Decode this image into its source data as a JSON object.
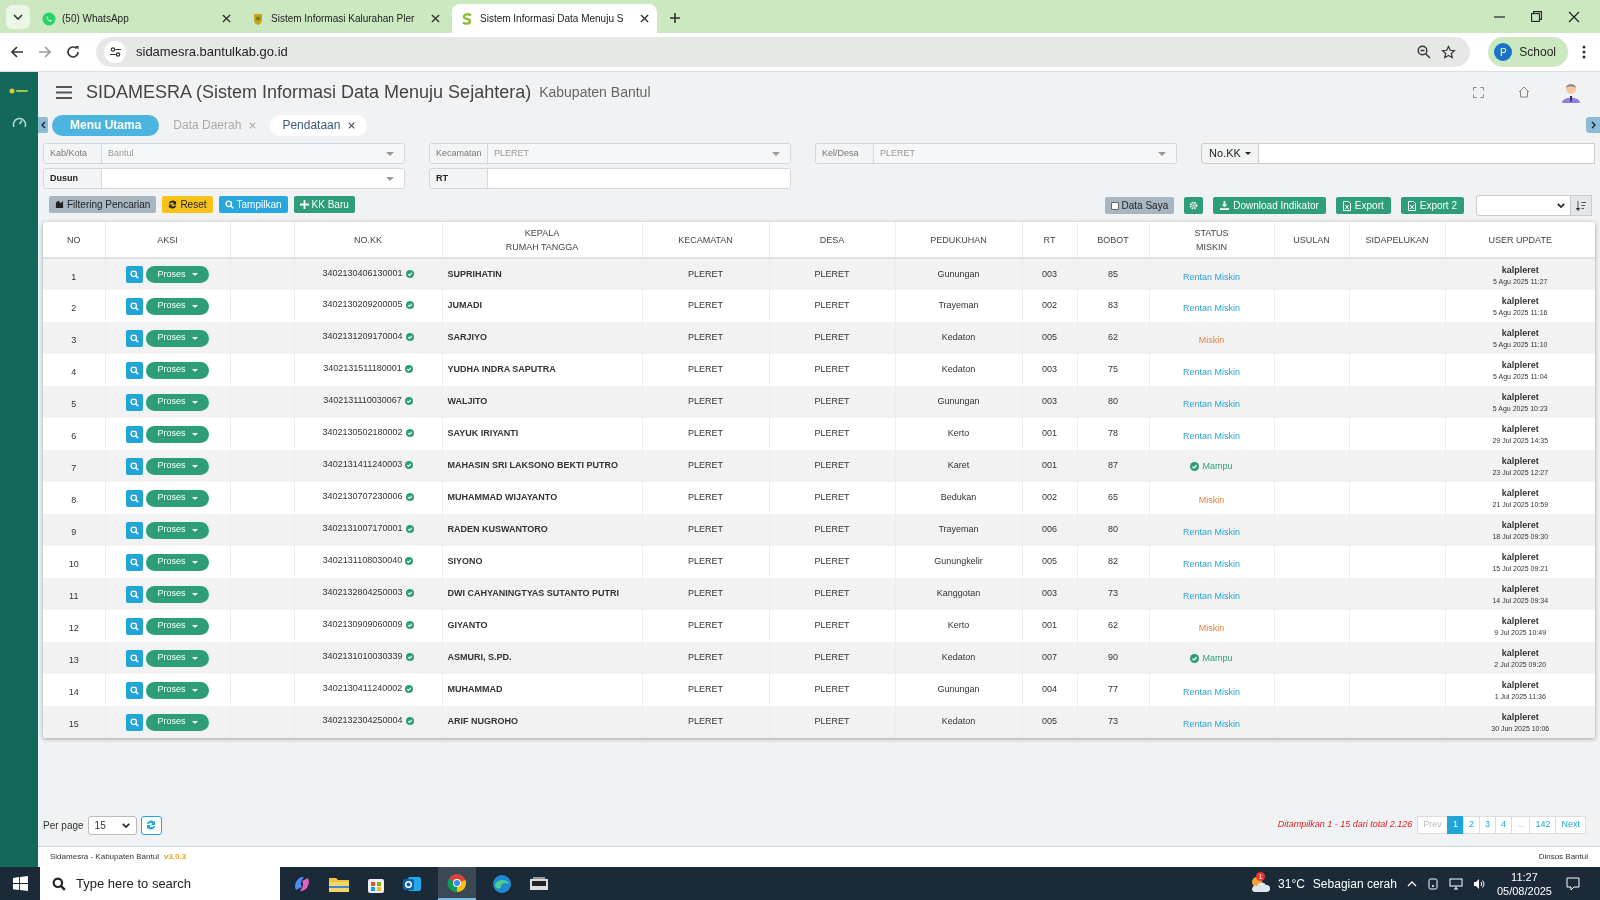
{
  "browser": {
    "tabs": [
      {
        "title": "(50) WhatsApp",
        "selected": false,
        "kind": "whatsapp"
      },
      {
        "title": "Sistem Informasi Kalurahan Pler",
        "selected": false,
        "kind": "emblem"
      },
      {
        "title": "Sistem Informasi Data Menuju S",
        "selected": true,
        "kind": "logo"
      }
    ],
    "url": "sidamesra.bantulkab.go.id",
    "profile": {
      "initial": "P",
      "label": "School"
    }
  },
  "app": {
    "title": "SIDAMESRA (Sistem Informasi Data Menuju Sejahtera)",
    "subtitle": "Kabupaten Bantul",
    "tabs": [
      {
        "label": "Menu Utama",
        "kind": "home",
        "selected": false,
        "closable": false
      },
      {
        "label": "Data Daerah",
        "kind": "page",
        "selected": false,
        "closable": true
      },
      {
        "label": "Pendataan",
        "kind": "page",
        "selected": true,
        "closable": true
      }
    ]
  },
  "filters": {
    "fields": [
      {
        "label": "Kab/Kota",
        "value": "Bantul",
        "disabled": true,
        "kind": "select"
      },
      {
        "label": "Kecamatan",
        "value": "PLERET",
        "disabled": true,
        "kind": "select"
      },
      {
        "label": "Kel/Desa",
        "value": "PLERET",
        "disabled": true,
        "kind": "select"
      },
      {
        "label": "Dusun",
        "disabled": false,
        "kind": "select"
      },
      {
        "label": "RT",
        "disabled": false,
        "kind": "text"
      }
    ],
    "search_by": "No.KK"
  },
  "toolbar": {
    "left": [
      {
        "label": "Filtering Pencarian",
        "kind": "filter"
      },
      {
        "label": "Reset",
        "kind": "reset"
      },
      {
        "label": "Tampilkan",
        "kind": "show"
      },
      {
        "label": "KK Baru",
        "kind": "add"
      }
    ],
    "data_saya": {
      "label": "Data Saya",
      "checked": false
    },
    "right": [
      {
        "label": "Download Indikator",
        "kind": "download"
      },
      {
        "label": "Export",
        "kind": "excel"
      },
      {
        "label": "Export 2",
        "kind": "excel"
      }
    ]
  },
  "table": {
    "columns": [
      "NO",
      "AKSI",
      "NO.KK",
      "KEPALA\nRUMAH TANGGA",
      "KECAMATAN",
      "DESA",
      "PEDUKUHAN",
      "RT",
      "BOBOT",
      "STATUS\nMISKIN",
      "USULAN",
      "SIDAPELUKAN",
      "USER UPDATE"
    ],
    "rows": [
      {
        "no": "1",
        "action": "Proses",
        "no_kk": "3402130406130001",
        "verified": true,
        "kepala": "SUPRIHATIN",
        "kecamatan": "PLERET",
        "desa": "PLERET",
        "pedukuhan": "Gunungan",
        "rt": "003",
        "bobot": "85",
        "status": {
          "label": "Rentan Miskin",
          "kind": "rentan"
        },
        "user": "kalpleret",
        "updated": "5 Agu 2025 11:27"
      },
      {
        "no": "2",
        "action": "Proses",
        "no_kk": "3402130209200005",
        "verified": true,
        "kepala": "JUMADI",
        "kecamatan": "PLERET",
        "desa": "PLERET",
        "pedukuhan": "Trayeman",
        "rt": "002",
        "bobot": "83",
        "status": {
          "label": "Rentan Miskin",
          "kind": "rentan"
        },
        "user": "kalpleret",
        "updated": "5 Agu 2025 11:16"
      },
      {
        "no": "3",
        "action": "Proses",
        "no_kk": "3402131209170004",
        "verified": true,
        "kepala": "SARJIYO",
        "kecamatan": "PLERET",
        "desa": "PLERET",
        "pedukuhan": "Kedaton",
        "rt": "005",
        "bobot": "62",
        "status": {
          "label": "Miskin",
          "kind": "miskin"
        },
        "user": "kalpleret",
        "updated": "5 Agu 2025 11:10"
      },
      {
        "no": "4",
        "action": "Proses",
        "no_kk": "3402131511180001",
        "verified": true,
        "kepala": "YUDHA INDRA SAPUTRA",
        "kecamatan": "PLERET",
        "desa": "PLERET",
        "pedukuhan": "Kedaton",
        "rt": "003",
        "bobot": "75",
        "status": {
          "label": "Rentan Miskin",
          "kind": "rentan"
        },
        "user": "kalpleret",
        "updated": "5 Agu 2025 11:04"
      },
      {
        "no": "5",
        "action": "Proses",
        "no_kk": "3402131110030067",
        "verified": true,
        "kepala": "WALJITO",
        "kecamatan": "PLERET",
        "desa": "PLERET",
        "pedukuhan": "Gunungan",
        "rt": "003",
        "bobot": "80",
        "status": {
          "label": "Rentan Miskin",
          "kind": "rentan"
        },
        "user": "kalpleret",
        "updated": "5 Agu 2025 10:23"
      },
      {
        "no": "6",
        "action": "Proses",
        "no_kk": "3402130502180002",
        "verified": true,
        "kepala": "SAYUK IRIYANTI",
        "kecamatan": "PLERET",
        "desa": "PLERET",
        "pedukuhan": "Kerto",
        "rt": "001",
        "bobot": "78",
        "status": {
          "label": "Rentan Miskin",
          "kind": "rentan"
        },
        "user": "kalpleret",
        "updated": "29 Jul 2025 14:35"
      },
      {
        "no": "7",
        "action": "Proses",
        "no_kk": "3402131411240003",
        "verified": true,
        "kepala": "MAHASIN SRI LAKSONO BEKTI PUTRO",
        "kecamatan": "PLERET",
        "desa": "PLERET",
        "pedukuhan": "Karet",
        "rt": "001",
        "bobot": "87",
        "status": {
          "label": "Mampu",
          "kind": "mampu"
        },
        "user": "kalpleret",
        "updated": "23 Jul 2025 12:27"
      },
      {
        "no": "8",
        "action": "Proses",
        "no_kk": "3402130707230006",
        "verified": true,
        "kepala": "MUHAMMAD WIJAYANTO",
        "kecamatan": "PLERET",
        "desa": "PLERET",
        "pedukuhan": "Bedukan",
        "rt": "002",
        "bobot": "65",
        "status": {
          "label": "Miskin",
          "kind": "miskin"
        },
        "user": "kalpleret",
        "updated": "21 Jul 2025 10:59"
      },
      {
        "no": "9",
        "action": "Proses",
        "no_kk": "3402131007170001",
        "verified": true,
        "kepala": "RADEN KUSWANTORO",
        "kecamatan": "PLERET",
        "desa": "PLERET",
        "pedukuhan": "Trayeman",
        "rt": "006",
        "bobot": "80",
        "status": {
          "label": "Rentan Miskin",
          "kind": "rentan"
        },
        "user": "kalpleret",
        "updated": "18 Jul 2025 09:30"
      },
      {
        "no": "10",
        "action": "Proses",
        "no_kk": "3402131108030040",
        "verified": true,
        "kepala": "SIYONO",
        "kecamatan": "PLERET",
        "desa": "PLERET",
        "pedukuhan": "Gunungkelir",
        "rt": "005",
        "bobot": "82",
        "status": {
          "label": "Rentan Miskin",
          "kind": "rentan"
        },
        "user": "kalpleret",
        "updated": "15 Jul 2025 09:21"
      },
      {
        "no": "11",
        "action": "Proses",
        "no_kk": "3402132804250003",
        "verified": true,
        "kepala": "DWI CAHYANINGTYAS SUTANTO PUTRI",
        "kecamatan": "PLERET",
        "desa": "PLERET",
        "pedukuhan": "Kanggotan",
        "rt": "003",
        "bobot": "73",
        "status": {
          "label": "Rentan Miskin",
          "kind": "rentan"
        },
        "user": "kalpleret",
        "updated": "14 Jul 2025 09:34"
      },
      {
        "no": "12",
        "action": "Proses",
        "no_kk": "3402130909060009",
        "verified": true,
        "kepala": "GIYANTO",
        "kecamatan": "PLERET",
        "desa": "PLERET",
        "pedukuhan": "Kerto",
        "rt": "001",
        "bobot": "62",
        "status": {
          "label": "Miskin",
          "kind": "miskin"
        },
        "user": "kalpleret",
        "updated": "9 Jul 2025 10:49"
      },
      {
        "no": "13",
        "action": "Proses",
        "no_kk": "3402131010030339",
        "verified": true,
        "kepala": "ASMURI, S.PD.",
        "kecamatan": "PLERET",
        "desa": "PLERET",
        "pedukuhan": "Kedaton",
        "rt": "007",
        "bobot": "90",
        "status": {
          "label": "Mampu",
          "kind": "mampu"
        },
        "user": "kalpleret",
        "updated": "2 Jul 2025 09:20"
      },
      {
        "no": "14",
        "action": "Proses",
        "no_kk": "3402130411240002",
        "verified": true,
        "kepala": "MUHAMMAD",
        "kecamatan": "PLERET",
        "desa": "PLERET",
        "pedukuhan": "Gunungan",
        "rt": "004",
        "bobot": "77",
        "status": {
          "label": "Rentan Miskin",
          "kind": "rentan"
        },
        "user": "kalpleret",
        "updated": "1 Jul 2025 11:36"
      },
      {
        "no": "15",
        "action": "Proses",
        "no_kk": "3402132304250004",
        "verified": true,
        "kepala": "ARIF NUGROHO",
        "kecamatan": "PLERET",
        "desa": "PLERET",
        "pedukuhan": "Kedaton",
        "rt": "005",
        "bobot": "73",
        "status": {
          "label": "Rentan Miskin",
          "kind": "rentan"
        },
        "user": "kalpleret",
        "updated": "30 Jun 2025 10:06"
      }
    ]
  },
  "pagination": {
    "per_page_label": "Per page",
    "per_page": "15",
    "info": "Ditampilkan 1 - 15 dari total 2.126",
    "pages": [
      {
        "label": "Prev",
        "selected": false,
        "disabled": true
      },
      {
        "label": "1",
        "selected": true,
        "disabled": false
      },
      {
        "label": "2",
        "selected": false,
        "disabled": false
      },
      {
        "label": "3",
        "selected": false,
        "disabled": false
      },
      {
        "label": "4",
        "selected": false,
        "disabled": false
      },
      {
        "label": "...",
        "selected": false,
        "disabled": true
      },
      {
        "label": "142",
        "selected": false,
        "disabled": false
      },
      {
        "label": "Next",
        "selected": false,
        "disabled": false
      }
    ]
  },
  "footer": {
    "left": "Sidamesra - Kabupaten Bantul",
    "version": "v3.0.3",
    "right": "Dinsos Bantul"
  },
  "taskbar": {
    "search_placeholder": "Type here to search",
    "weather_badge": "1",
    "temperature": "31°C",
    "weather": "Sebagian cerah",
    "time": "11:27",
    "date": "05/08/2025"
  }
}
